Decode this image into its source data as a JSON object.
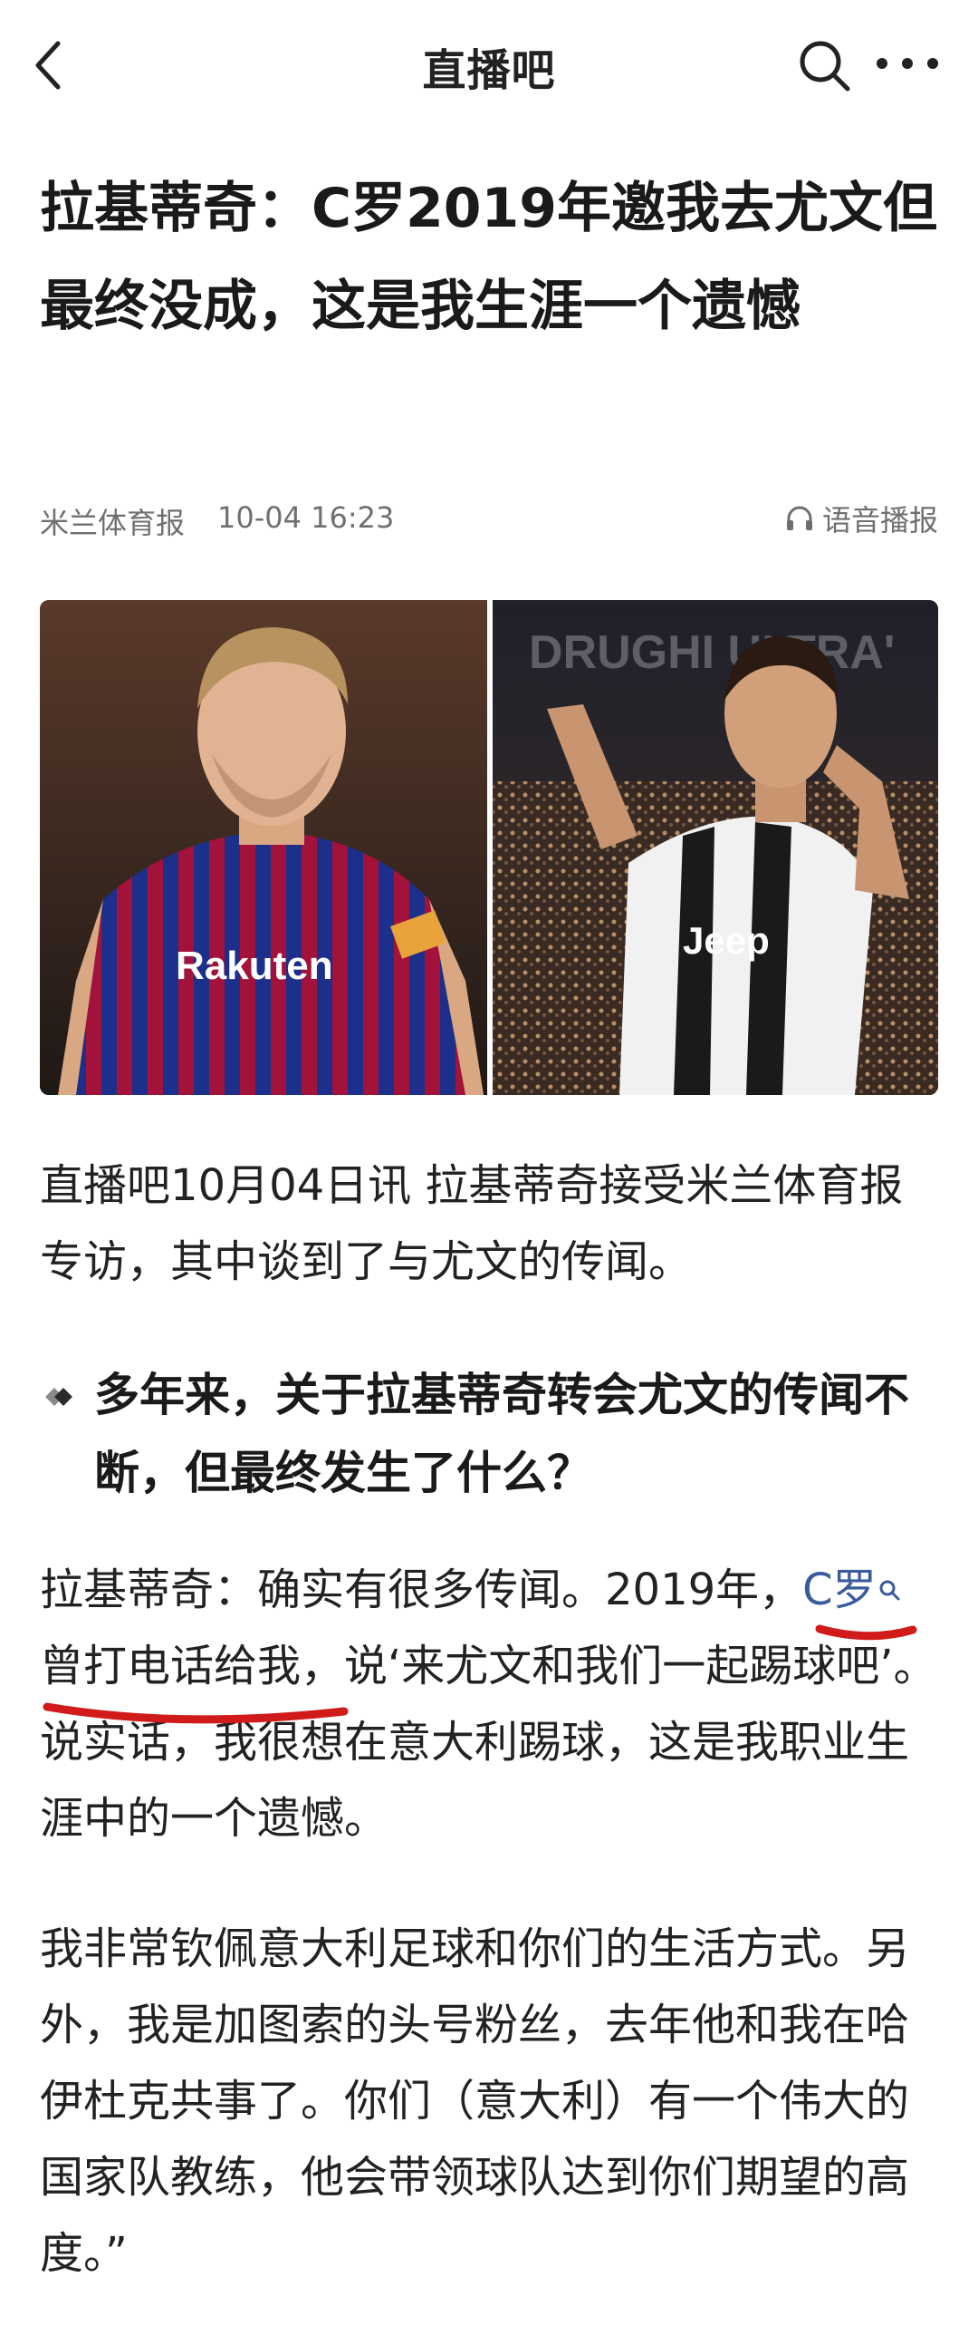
{
  "topbar": {
    "title": "直播吧",
    "back_icon": "back-arrow-icon",
    "search_icon": "search-icon",
    "more_icon": "more-icon"
  },
  "article": {
    "title": "拉基蒂奇：C罗2019年邀我去尤文但最终没成，这是我生涯一个遗憾",
    "source": "米兰体育报",
    "time": "10-04 16:23",
    "audio_label": "语音播报",
    "audio_icon": "headphones-icon",
    "hero_image": {
      "left_jersey_brand": "Rakuten",
      "right_jersey_brand": "Jeep",
      "stadium_banner": "DRUGHI ULTRA'"
    },
    "para1": "直播吧10月04日讯 拉基蒂奇接受米兰体育报专访，其中谈到了与尤文的传闻。",
    "question": "多年来，关于拉基蒂奇转会尤文的传闻不断，但最终发生了什么？",
    "para2": {
      "before_link": "拉基蒂奇：确实有很多传闻。2019年，",
      "link": "C罗",
      "after_link": "曾打电话给我，说‘来尤文和我们一起踢球吧’。说实话，我很想在意大利踢球，这是我职业生涯中的一个遗憾。"
    },
    "para3": "我非常钦佩意大利足球和你们的生活方式。另外，我是加图索的头号粉丝，去年他和我在哈伊杜克共事了。你们（意大利）有一个伟大的国家队教练，他会带领球队达到你们期望的高度。”"
  },
  "colors": {
    "link": "#3a5b9c",
    "annotation": "#d11a1a",
    "meta": "#6f6f6f"
  }
}
